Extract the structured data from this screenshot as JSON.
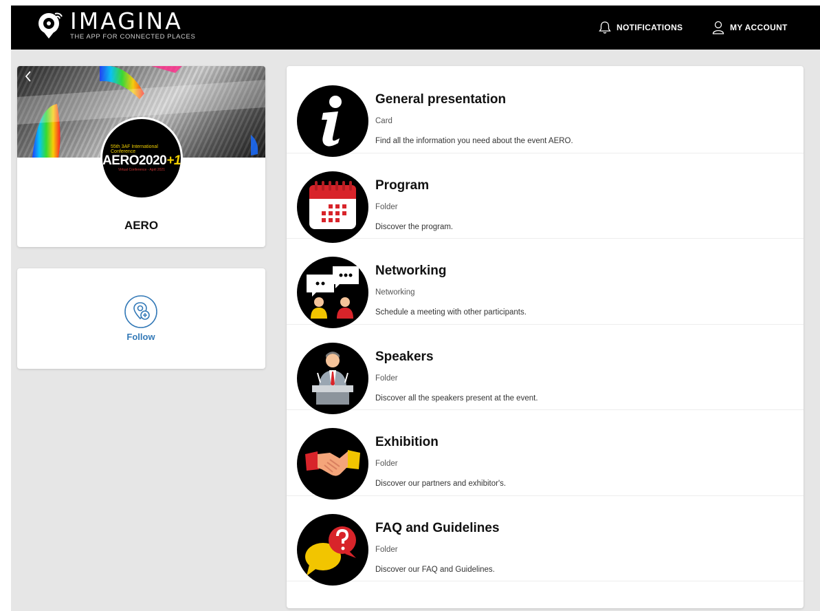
{
  "header": {
    "brand": "IMAGINA",
    "tagline": "THE APP FOR CONNECTED PLACES",
    "notifications_label": "NOTIFICATIONS",
    "account_label": "MY ACCOUNT"
  },
  "event": {
    "name": "AERO",
    "logo_sup": "55th 3AF International Conference",
    "logo_main": "AERO2020",
    "logo_accent": "+1",
    "logo_small": "Virtual Conference - April 2021"
  },
  "follow": {
    "label": "Follow",
    "accent": "#3379b7"
  },
  "menu": [
    {
      "title": "General presentation",
      "type": "Card",
      "description": "Find all the information you need about the event AERO.",
      "icon": "info-icon"
    },
    {
      "title": "Program",
      "type": "Folder",
      "description": "Discover the program.",
      "icon": "calendar-icon"
    },
    {
      "title": "Networking",
      "type": "Networking",
      "description": "Schedule a meeting with other participants.",
      "icon": "chat-people-icon"
    },
    {
      "title": "Speakers",
      "type": "Folder",
      "description": "Discover all the speakers present at the event.",
      "icon": "speaker-podium-icon"
    },
    {
      "title": "Exhibition",
      "type": "Folder",
      "description": "Discover our partners and exhibitor's.",
      "icon": "handshake-icon"
    },
    {
      "title": "FAQ and Guidelines",
      "type": "Folder",
      "description": "Discover our FAQ and Guidelines.",
      "icon": "faq-bubble-icon"
    }
  ]
}
